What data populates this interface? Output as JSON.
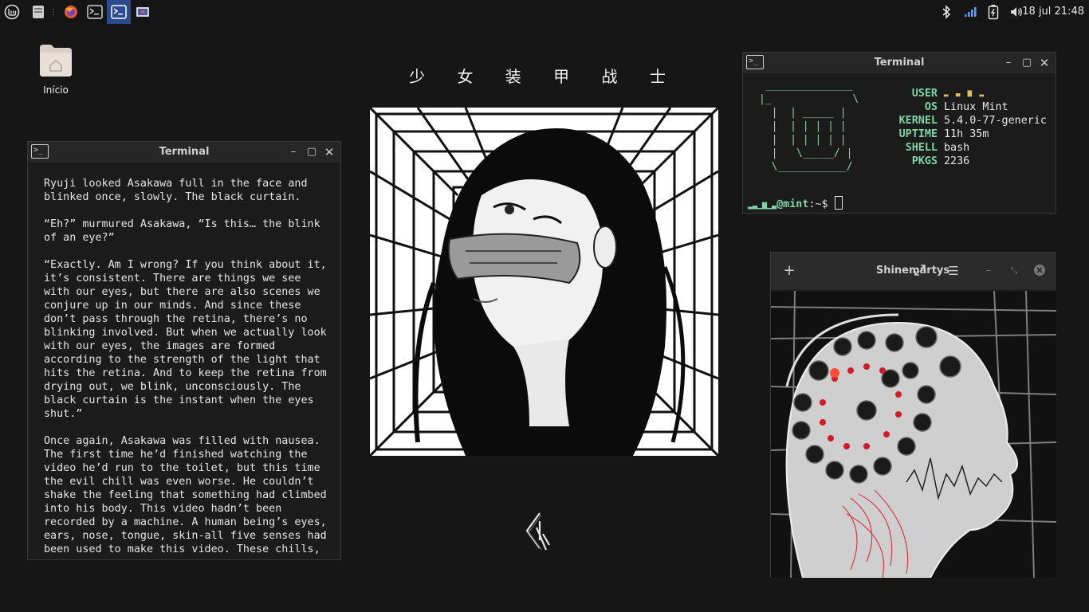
{
  "panel": {
    "menu_icon": "linux-mint-menu-icon",
    "launchers": [
      "file-manager-icon",
      "firefox-icon",
      "terminal-icon",
      "terminal-icon",
      "image-viewer-icon"
    ],
    "tray_icons": [
      "bluetooth-icon",
      "network-signal-icon",
      "battery-icon",
      "volume-icon"
    ],
    "clock": "18 jul 21:48"
  },
  "desktop": {
    "home_label": "Início"
  },
  "artwork": {
    "title": "少 女 装 甲 战 士"
  },
  "left_terminal": {
    "title": "Terminal",
    "text": "Ryuji looked Asakawa full in the face and\nblinked once, slowly. The black curtain.\n\n“Eh?” murmured Asakawa, “Is this… the blink\nof an eye?”\n\n“Exactly. Am I wrong? If you think about it,\nit’s consistent. There are things we see\nwith our eyes, but there are also scenes we\nconjure up in our minds. And since these\ndon’t pass through the retina, there’s no\nblinking involved. But when we actually look\nwith our eyes, the images are formed\naccording to the strength of the light that\nhits the retina. And to keep the retina from\ndrying out, we blink, unconsciously. The\nblack curtain is the instant when the eyes\nshut.”\n\nOnce again, Asakawa was filled with nausea.\nThe first time he’d finished watching the\nvideo he’d run to the toilet, but this time\nthe evil chill was even worse. He couldn’t\nshake the feeling that something had climbed\ninto his body. This video hadn’t been\nrecorded by a machine. A human being’s eyes,\nears, nose, tongue, skin-all five senses had\nbeen used to make this video. These chills,"
  },
  "right_terminal": {
    "title": "Terminal",
    "info": [
      {
        "key": "USER",
        "value": ""
      },
      {
        "key": "OS",
        "value": "Linux Mint"
      },
      {
        "key": "KERNEL",
        "value": "5.4.0-77-generic"
      },
      {
        "key": "UPTIME",
        "value": "11h 35m"
      },
      {
        "key": "SHELL",
        "value": "bash"
      },
      {
        "key": "PKGS",
        "value": "2236"
      }
    ],
    "prompt_host": "@mint",
    "prompt_path": ":~$ "
  },
  "image_viewer": {
    "title": "Shinemartys",
    "add_icon": "plus-icon",
    "fullscreen_icon": "expand-icon",
    "menu_icon": "hamburger-menu-icon"
  },
  "colors": {
    "background": "#161616",
    "terminal_accent": "#7ed4a6"
  }
}
